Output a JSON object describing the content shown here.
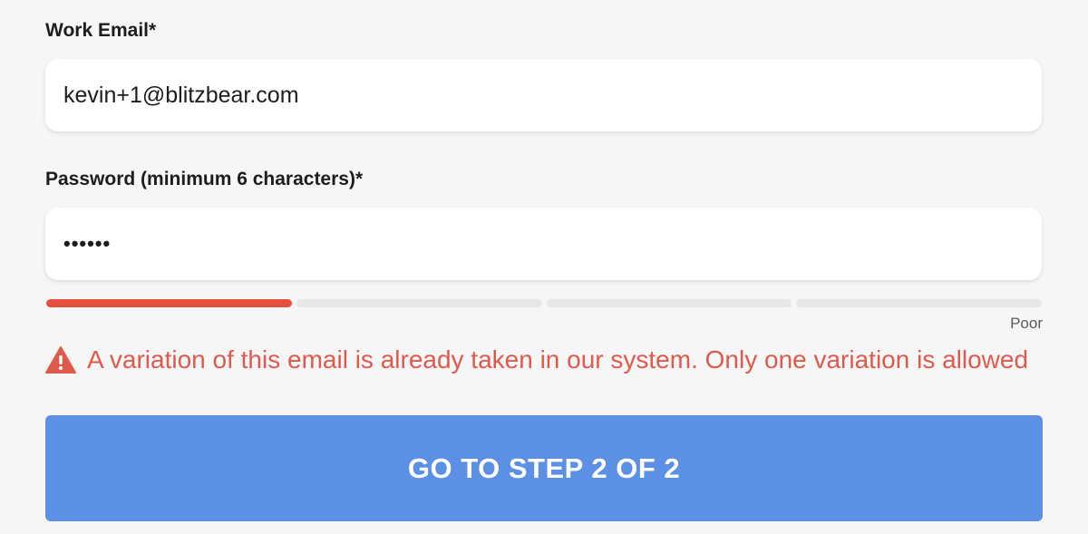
{
  "form": {
    "email_label": "Work Email*",
    "email_value": "kevin+1@blitzbear.com",
    "password_label": "Password (minimum 6 characters)*",
    "password_mask": "••••••",
    "strength": {
      "label": "Poor",
      "filled_segments": 1,
      "total_segments": 4,
      "color_filled": "#e4503c",
      "color_empty": "#e7e7e7"
    },
    "error": {
      "icon": "warning-triangle-icon",
      "message": "A variation of this email is already taken in our system. Only one variation is allowed",
      "color": "#de5a4c"
    },
    "submit_label": "GO TO STEP 2 OF 2",
    "submit_color": "#5b90e5"
  }
}
